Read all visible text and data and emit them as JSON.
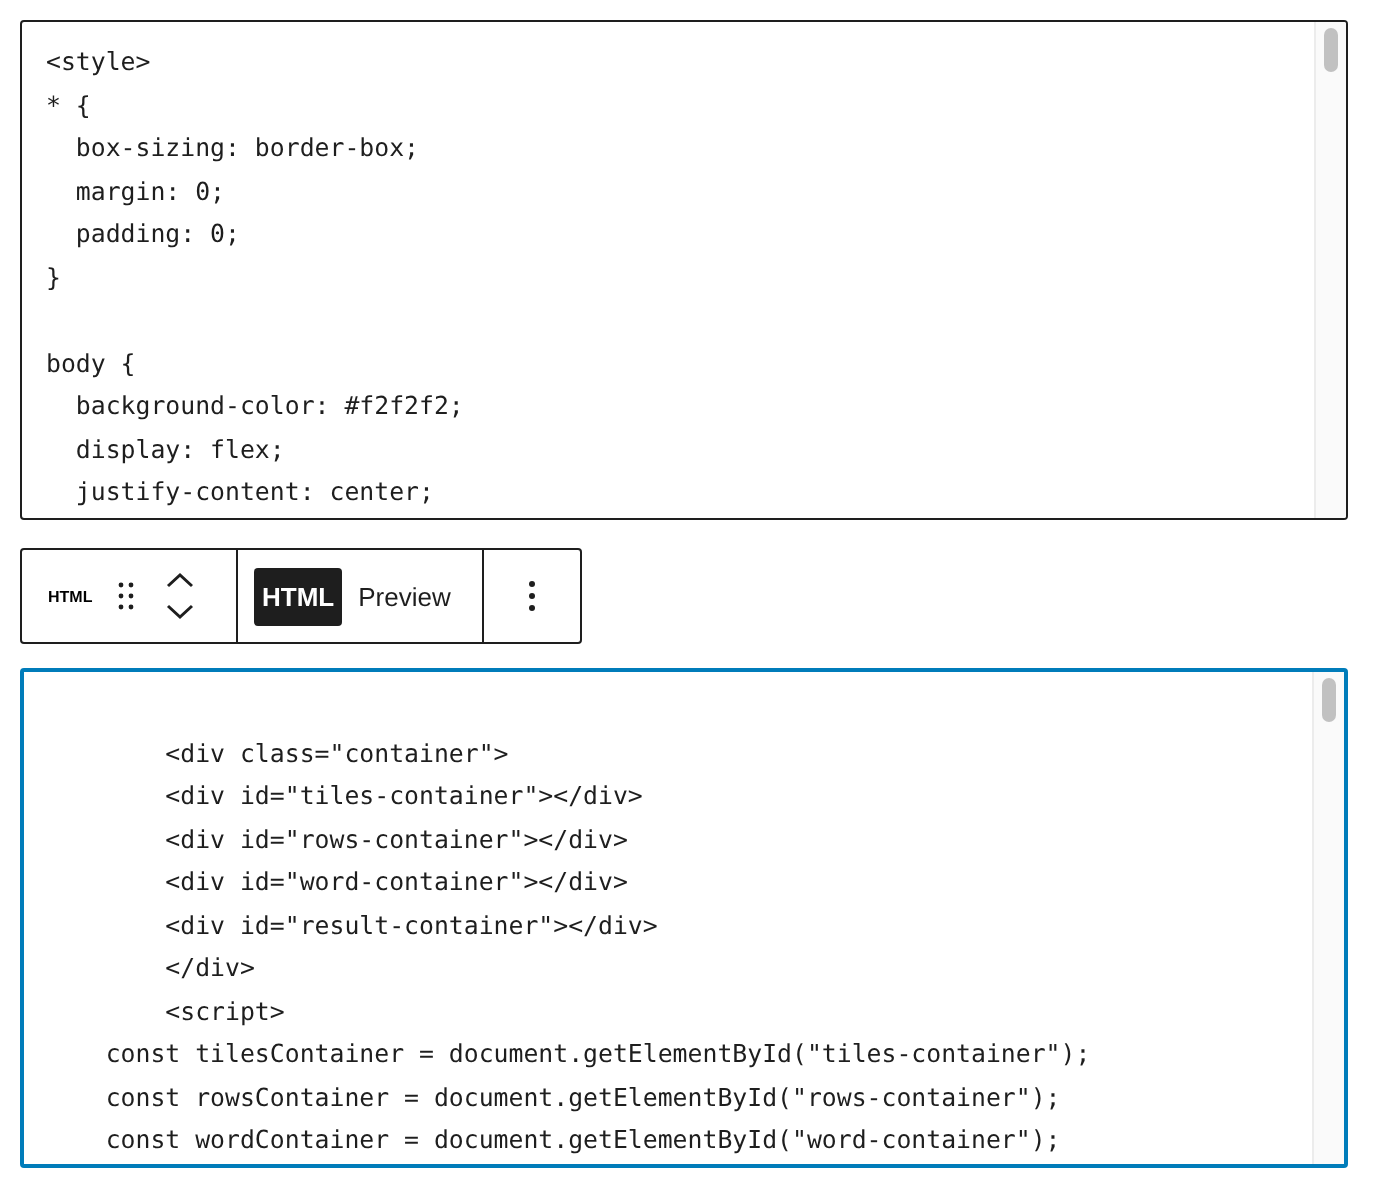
{
  "editors": [
    {
      "focused": false,
      "lines": [
        {
          "kind": "code",
          "text": "<style>"
        },
        {
          "kind": "code",
          "text": "* {"
        },
        {
          "kind": "code",
          "text": "  box-sizing: border-box;"
        },
        {
          "kind": "code",
          "text": "  margin: 0;"
        },
        {
          "kind": "code",
          "text": "  padding: 0;"
        },
        {
          "kind": "code",
          "text": "}"
        },
        {
          "kind": "blank"
        },
        {
          "kind": "code",
          "text": "body {"
        },
        {
          "kind": "code",
          "text": "  background-color: #f2f2f2;"
        },
        {
          "kind": "code",
          "text": "  display: flex;"
        },
        {
          "kind": "code",
          "text": "  justify-content: center;"
        }
      ]
    },
    {
      "focused": true,
      "lines": [
        {
          "kind": "blank"
        },
        {
          "kind": "code",
          "text": "        <div class=\"container\">"
        },
        {
          "kind": "code",
          "text": "        <div id=\"tiles-container\"></div>"
        },
        {
          "kind": "code",
          "text": "        <div id=\"rows-container\"></div>"
        },
        {
          "kind": "code",
          "text": "        <div id=\"word-container\"></div>"
        },
        {
          "kind": "code",
          "text": "        <div id=\"result-container\"></div>"
        },
        {
          "kind": "code",
          "text": "        </div>"
        },
        {
          "kind": "code",
          "text": "        <script>"
        },
        {
          "kind": "code",
          "text": "    const tilesContainer = document.getElementById(\"tiles-container\");"
        },
        {
          "kind": "code",
          "text": "    const rowsContainer = document.getElementById(\"rows-container\");"
        },
        {
          "kind": "code",
          "text": "    const wordContainer = document.getElementById(\"word-container\");"
        }
      ]
    }
  ],
  "toolbar": {
    "block_label": "HTML",
    "tabs": [
      {
        "label": "HTML",
        "selected": true
      },
      {
        "label": "Preview",
        "selected": false
      }
    ]
  }
}
